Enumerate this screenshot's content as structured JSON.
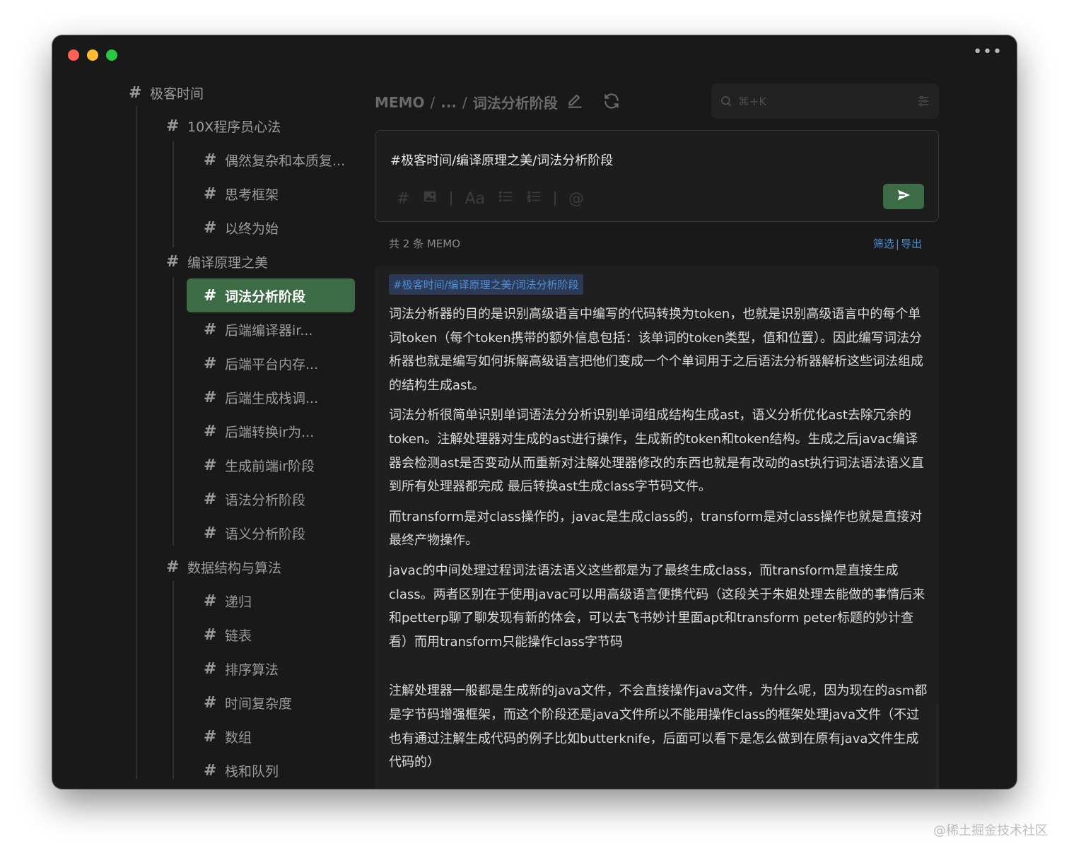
{
  "sidebar": {
    "items": [
      {
        "hash": "#",
        "label": "极客时间"
      },
      {
        "hash": "#",
        "label": "10X程序员心法"
      },
      {
        "hash": "#",
        "label": "偶然复杂和本质复..."
      },
      {
        "hash": "#",
        "label": "思考框架"
      },
      {
        "hash": "#",
        "label": "以终为始"
      },
      {
        "hash": "#",
        "label": "编译原理之美"
      },
      {
        "hash": "#",
        "label": "词法分析阶段"
      },
      {
        "hash": "#",
        "label": "后端编译器ir..."
      },
      {
        "hash": "#",
        "label": "后端平台内存..."
      },
      {
        "hash": "#",
        "label": "后端生成栈调..."
      },
      {
        "hash": "#",
        "label": "后端转换ir为..."
      },
      {
        "hash": "#",
        "label": "生成前端ir阶段"
      },
      {
        "hash": "#",
        "label": "语法分析阶段"
      },
      {
        "hash": "#",
        "label": "语义分析阶段"
      },
      {
        "hash": "#",
        "label": "数据结构与算法"
      },
      {
        "hash": "#",
        "label": "递归"
      },
      {
        "hash": "#",
        "label": "链表"
      },
      {
        "hash": "#",
        "label": "排序算法"
      },
      {
        "hash": "#",
        "label": "时间复杂度"
      },
      {
        "hash": "#",
        "label": "数组"
      },
      {
        "hash": "#",
        "label": "栈和队列"
      }
    ]
  },
  "header": {
    "breadcrumb": [
      "MEMO",
      "...",
      "词法分析阶段"
    ],
    "separator": "/",
    "edit_icon": "pencil-icon",
    "refresh_icon": "refresh-icon"
  },
  "search": {
    "placeholder": "⌘+K",
    "icon": "search-icon",
    "filter_icon": "sliders-icon"
  },
  "editor": {
    "content": "#极客时间/编译原理之美/词法分析阶段",
    "toolbar": {
      "hash": "#",
      "image": "image-icon",
      "font": "Aa",
      "bullet_list": "list-icon",
      "ordered_list": "ordered-list-icon",
      "mention": "@"
    },
    "send_icon": "send-icon"
  },
  "list": {
    "count": "共 2 条 MEMO",
    "filter": "筛选",
    "separator": "|",
    "export": "导出"
  },
  "memo": {
    "tag": "#极客时间/编译原理之美/词法分析阶段",
    "paragraphs": [
      "词法分析器的目的是识别高级语言中编写的代码转换为token，也就是识别高级语言中的每个单词token（每个token携带的额外信息包括：该单词的token类型，值和位置）。因此编写词法分析器也就是编写如何拆解高级语言把他们变成一个个单词用于之后语法分析器解析这些词法组成的结构生成ast。",
      "词法分析很简单识别单词语法分分析识别单词组成结构生成ast，语义分析优化ast去除冗余的token。注解处理器对生成的ast进行操作，生成新的token和token结构。生成之后javac编译器会检测ast是否变动从而重新对注解处理器修改的东西也就是有改动的ast执行词法语法语义直到所有处理器都完成 最后转换ast生成class字节码文件。",
      "而transform是对class操作的，javac是生成class的，transform是对class操作也就是直接对最终产物操作。",
      "javac的中间处理过程词法语法语义这些都是为了最终生成class，而transform是直接生成class。两者区别在于使用javac可以用高级语言便携代码（这段关于朱姐处理去能做的事情后来和petterp聊了聊发现有新的体会，可以去飞书妙计里面apt和transform peter标题的妙计查看）而用transform只能操作class字节码",
      "注解处理器一般都是生成新的java文件，不会直接操作java文件，为什么呢，因为现在的asm都是字节码增强框架，而这个阶段还是java文件所以不能用操作class的框架处理java文件（不过也有通过注解生成代码的例子比如butterknife，后面可以看下是怎么做到在原有java文件生成代码的）"
    ]
  },
  "watermark": "@稀土掘金技术社区",
  "colors": {
    "window_bg": "#191919",
    "accent_green": "#3d6b46",
    "link_blue": "#4a8fd8",
    "tag_bg": "#2d3a55"
  }
}
